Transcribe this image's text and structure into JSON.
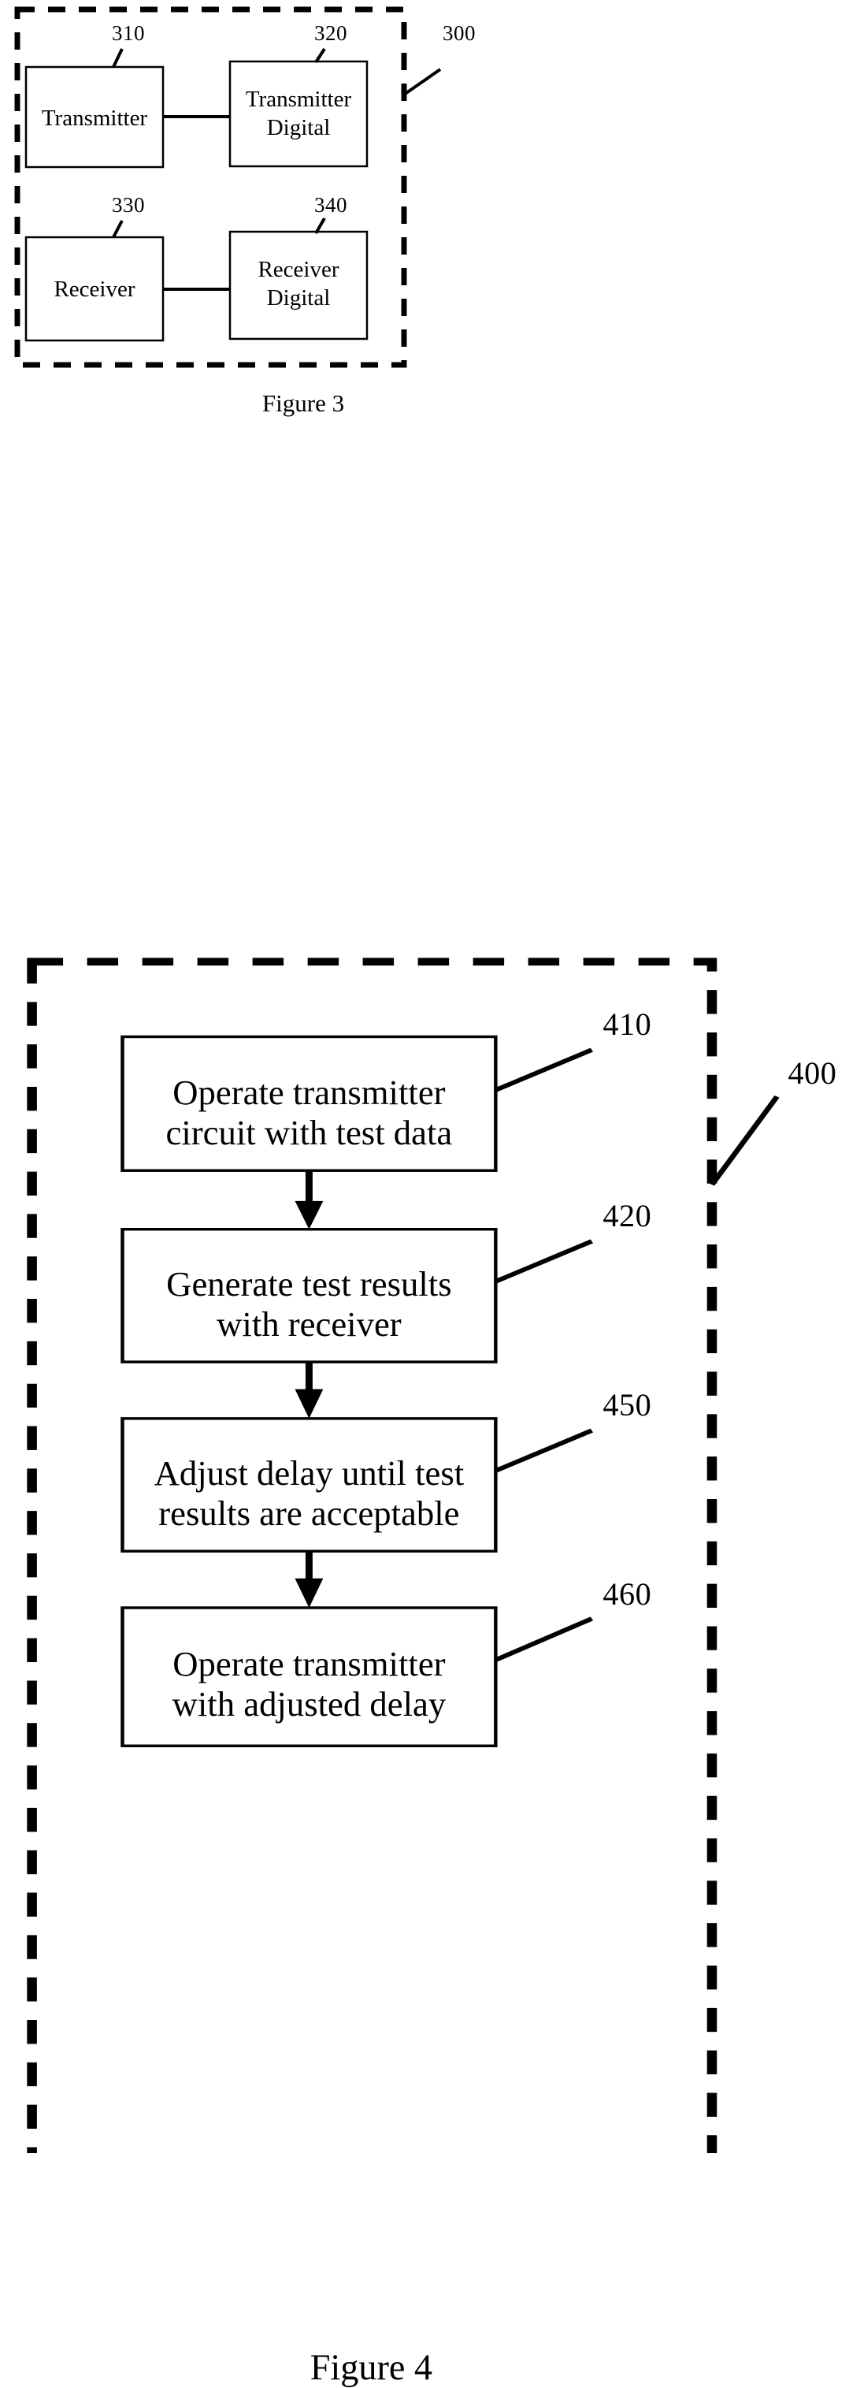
{
  "document": {
    "type": "patent-drawing-sheet",
    "figures": [
      {
        "id": "figure-3",
        "caption": "Figure 3",
        "reference_numeral": "300",
        "boundary": "dashed",
        "blocks": [
          {
            "ref": "310",
            "label": "Transmitter"
          },
          {
            "ref": "320",
            "label_line1": "Transmitter",
            "label_line2": "Digital"
          },
          {
            "ref": "330",
            "label": "Receiver"
          },
          {
            "ref": "340",
            "label_line1": "Receiver",
            "label_line2": "Digital"
          }
        ],
        "connections": [
          {
            "from": "310",
            "to": "320",
            "style": "solid-line"
          },
          {
            "from": "330",
            "to": "340",
            "style": "solid-line"
          }
        ]
      },
      {
        "id": "figure-4",
        "caption": "Figure 4",
        "reference_numeral": "400",
        "boundary": "dashed",
        "steps": [
          {
            "ref": "410",
            "line1": "Operate transmitter",
            "line2": "circuit with test data"
          },
          {
            "ref": "420",
            "line1": "Generate test results",
            "line2": "with receiver"
          },
          {
            "ref": "450",
            "line1": "Adjust delay until test",
            "line2": "results are acceptable"
          },
          {
            "ref": "460",
            "line1": "Operate transmitter",
            "line2": "with adjusted delay"
          }
        ],
        "connections": [
          {
            "from": "410",
            "to": "420",
            "style": "arrow-down"
          },
          {
            "from": "420",
            "to": "450",
            "style": "arrow-down"
          },
          {
            "from": "450",
            "to": "460",
            "style": "arrow-down"
          }
        ]
      }
    ],
    "colors": {
      "ink": "#000000",
      "paper": "#ffffff"
    }
  }
}
